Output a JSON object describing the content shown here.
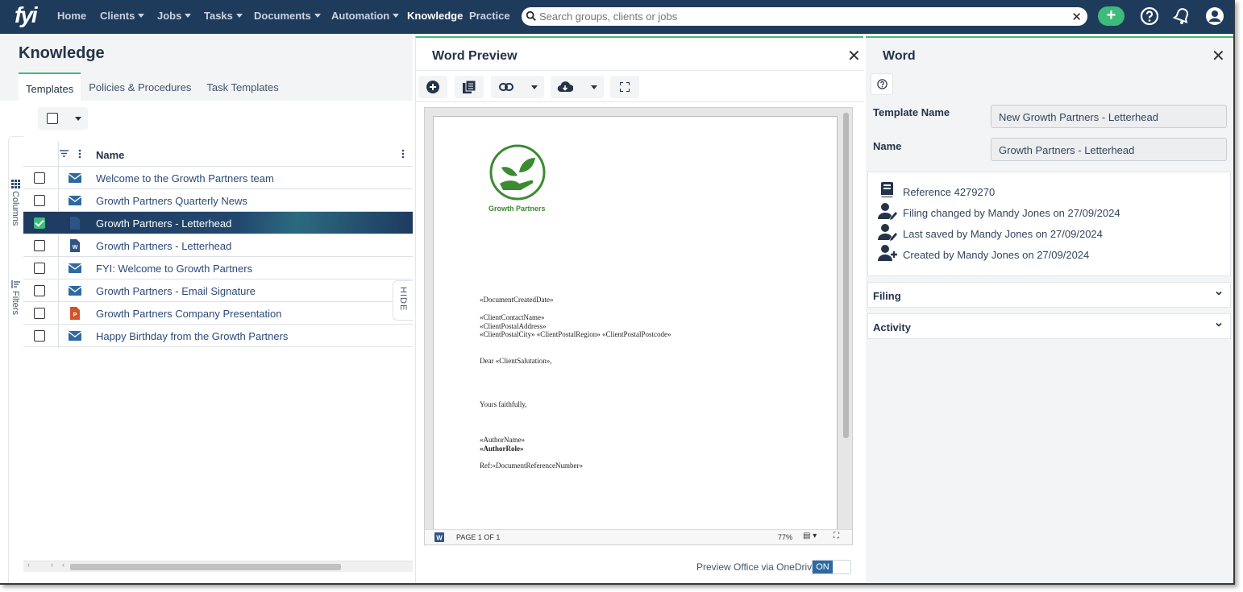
{
  "nav": {
    "logo": "fyi",
    "items": [
      "Home",
      "Clients",
      "Jobs",
      "Tasks",
      "Documents",
      "Automation",
      "Knowledge",
      "Practice"
    ],
    "search_placeholder": "Search groups, clients or jobs",
    "add_label": "+"
  },
  "knowledge": {
    "title": "Knowledge",
    "tabs": [
      "Templates",
      "Policies & Procedures",
      "Task Templates"
    ],
    "rail": {
      "columns": "Columns",
      "filters": "Filters"
    },
    "hide_label": "HIDE",
    "grid": {
      "name_header": "Name",
      "rows": [
        {
          "name": "Welcome to the Growth Partners team",
          "icon": "email-icon",
          "checked": false,
          "selected": false
        },
        {
          "name": "Growth Partners Quarterly News",
          "icon": "email-icon",
          "checked": false,
          "selected": false
        },
        {
          "name": "Growth Partners - Letterhead",
          "icon": "word-doc-icon",
          "checked": true,
          "selected": true
        },
        {
          "name": "Growth Partners - Letterhead",
          "icon": "word-doc-icon",
          "checked": false,
          "selected": false
        },
        {
          "name": "FYI: Welcome to Growth Partners",
          "icon": "email-icon",
          "checked": false,
          "selected": false
        },
        {
          "name": "Growth Partners - Email Signature",
          "icon": "email-icon",
          "checked": false,
          "selected": false
        },
        {
          "name": "Growth Partners Company Presentation",
          "icon": "powerpoint-icon",
          "checked": false,
          "selected": false
        },
        {
          "name": "Happy Birthday from the Growth Partners",
          "icon": "email-icon",
          "checked": false,
          "selected": false
        }
      ]
    }
  },
  "preview": {
    "title": "Word Preview",
    "document": {
      "logo_caption": "Growth Partners",
      "lines": {
        "created_date": "«DocumentCreatedDate»",
        "contact_name": "«ClientContactName»",
        "postal_address": "«ClientPostalAddress»",
        "postal_city": "«ClientPostalCity» «ClientPostalRegion» «ClientPostalPostcode»",
        "salutation": "Dear «ClientSalutation»,",
        "closing": "Yours faithfully,",
        "author_name": "«AuthorName»",
        "author_role": "«AuthorRole»",
        "reference": "Ref:«DocumentReferenceNumber»"
      },
      "page_label": "PAGE 1 OF 1",
      "zoom": "77%"
    },
    "onedrive_label": "Preview Office via OneDrive",
    "toggle_label": "ON"
  },
  "details": {
    "title": "Word",
    "template_name_label": "Template Name",
    "template_name_value": "New Growth Partners - Letterhead",
    "name_label": "Name",
    "name_value": "Growth Partners - Letterhead",
    "info": [
      "Reference 4279270",
      "Filing changed by Mandy Jones on 27/09/2024",
      "Last saved by Mandy Jones on 27/09/2024",
      "Created by Mandy Jones on 27/09/2024"
    ],
    "sections": [
      "Filing",
      "Activity"
    ]
  },
  "colors": {
    "nav_bg": "#1f3b5c",
    "accent_green": "#3dbb7a",
    "selected_row": "#1e3a5f",
    "link_blue": "#2b4a78",
    "toggle_blue": "#2d6aa3"
  }
}
